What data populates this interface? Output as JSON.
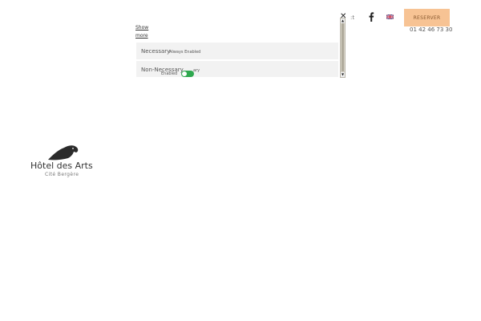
{
  "header": {
    "contact_text": ":t",
    "reserve_label": "RESERVER",
    "phone": "01 42 46 73 30",
    "facebook_icon": "facebook-icon",
    "flag_icon": "uk-flag-icon"
  },
  "cookie_popup": {
    "close_label": "✕",
    "show_more_label": "Show more",
    "necessary": {
      "title": "Necessary",
      "note": "Always Enabled"
    },
    "non_necessary": {
      "title": "Non-Necessary",
      "note_a": "ary",
      "note_b": "Enabled"
    }
  },
  "logo": {
    "title": "Hôtel des Arts",
    "subtitle": "Cité Bergère"
  },
  "colors": {
    "reserve_bg": "#f7c394",
    "toggle_on": "#2fa84f"
  }
}
